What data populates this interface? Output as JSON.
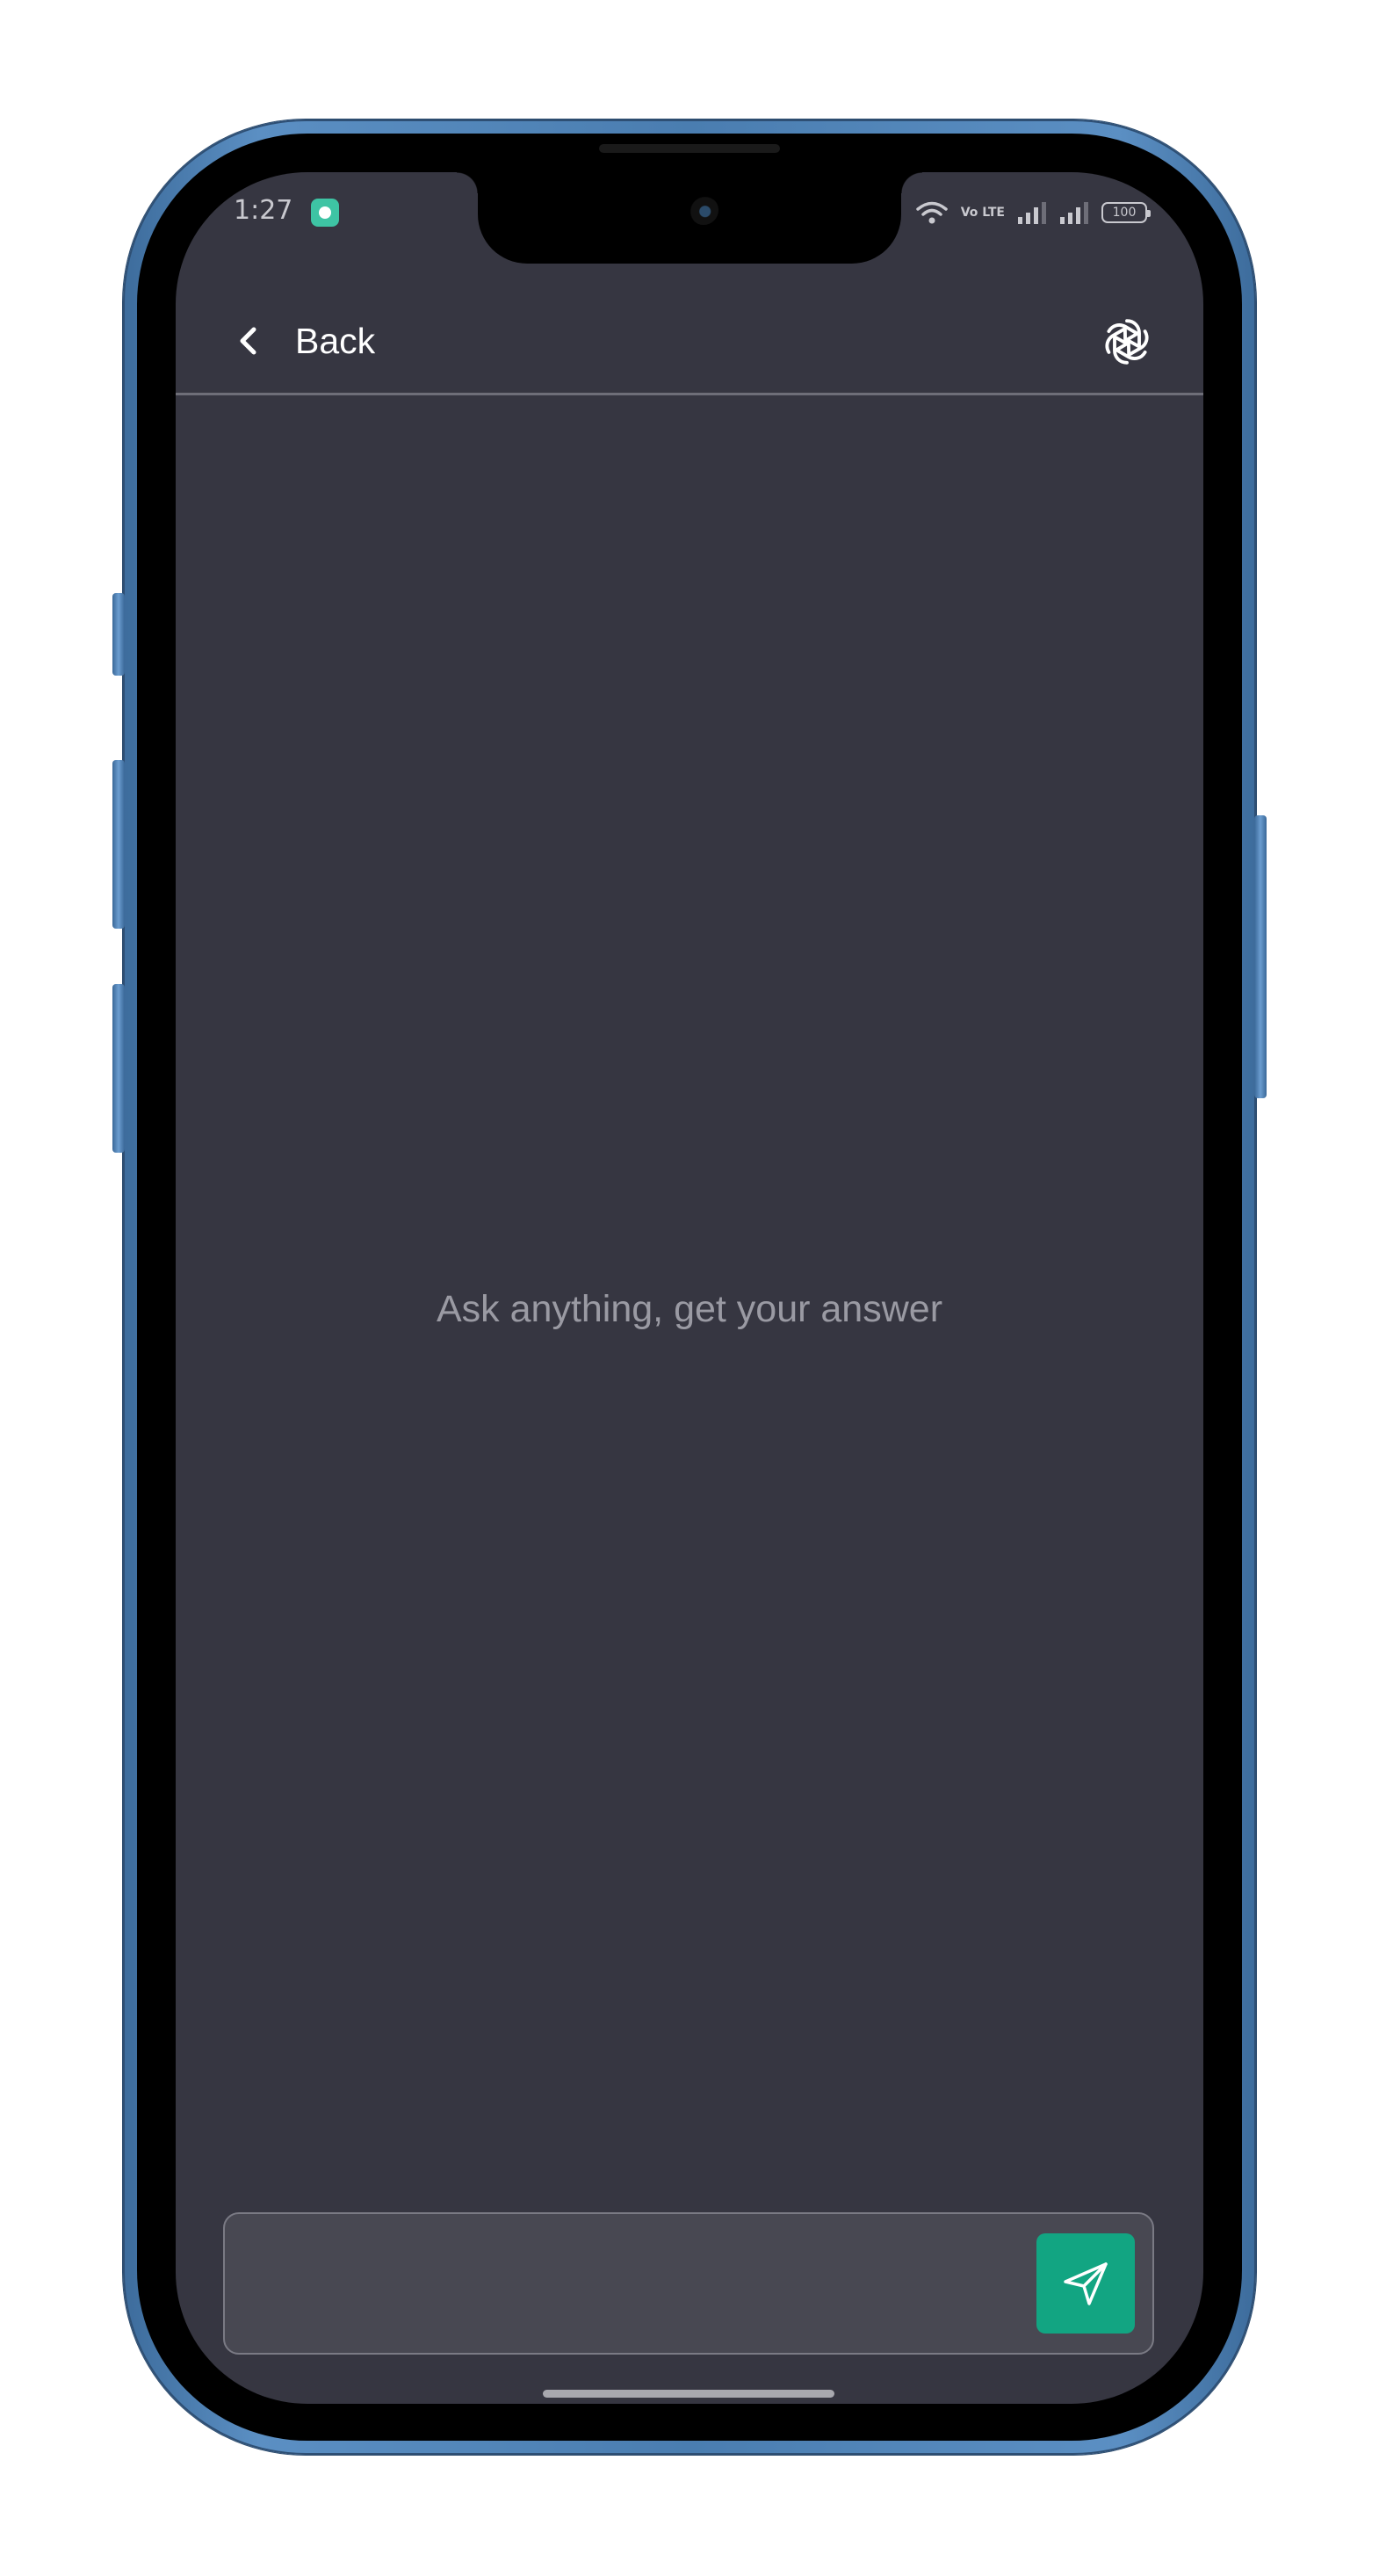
{
  "status_bar": {
    "time": "1:27",
    "volte": "Vo LTE",
    "battery": "100"
  },
  "header": {
    "back_label": "Back",
    "logo_icon": "openai-logo-icon",
    "back_icon": "chevron-left-icon"
  },
  "main": {
    "empty_state_text": "Ask anything, get your answer"
  },
  "composer": {
    "input_value": "",
    "input_placeholder": "",
    "send_icon": "paper-plane-icon"
  },
  "colors": {
    "background": "#363641",
    "header_divider": "#6e6e78",
    "composer_bg": "#484852",
    "accent": "#12a582",
    "muted_text": "#9a9aa3"
  }
}
